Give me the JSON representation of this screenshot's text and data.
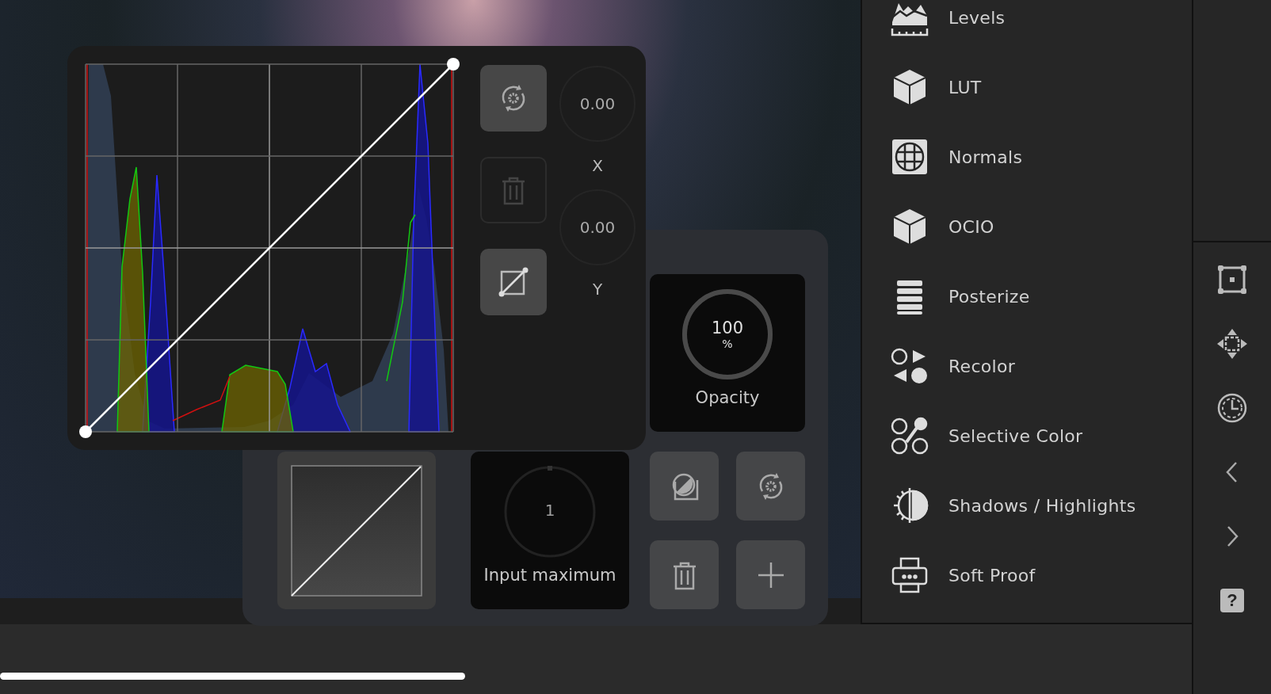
{
  "curves_panel": {
    "buttons": [
      {
        "kind": "reset",
        "disabled": false
      },
      {
        "kind": "delete",
        "disabled": true
      },
      {
        "kind": "curve",
        "disabled": false
      }
    ],
    "coordinates": [
      {
        "value": "0.00",
        "label": "X"
      },
      {
        "value": "0.00",
        "label": "Y"
      }
    ]
  },
  "layer_panel": {
    "opacity": {
      "value": "100",
      "unit": "%",
      "label": "Opacity",
      "level": 1
    },
    "input_maximum": {
      "value": "1",
      "label": "Input maximum"
    },
    "buttons": [
      {
        "kind": "mask"
      },
      {
        "kind": "reset"
      },
      {
        "kind": "delete"
      },
      {
        "kind": "add"
      }
    ]
  },
  "adjustments": [
    {
      "label": "Levels",
      "kind": "levels"
    },
    {
      "label": "LUT",
      "kind": "cube"
    },
    {
      "label": "Normals",
      "kind": "normals"
    },
    {
      "label": "OCIO",
      "kind": "cube"
    },
    {
      "label": "Posterize",
      "kind": "posterize"
    },
    {
      "label": "Recolor",
      "kind": "recolor"
    },
    {
      "label": "Selective Color",
      "kind": "selective"
    },
    {
      "label": "Shadows / Highlights",
      "kind": "shadows"
    },
    {
      "label": "Soft Proof",
      "kind": "printer"
    }
  ],
  "toolbar": [
    {
      "kind": "transform"
    },
    {
      "kind": "move"
    },
    {
      "kind": "history"
    },
    {
      "kind": "back"
    },
    {
      "kind": "forward"
    },
    {
      "kind": "help",
      "label": "?"
    }
  ],
  "timeline": {
    "level": 0.39
  }
}
